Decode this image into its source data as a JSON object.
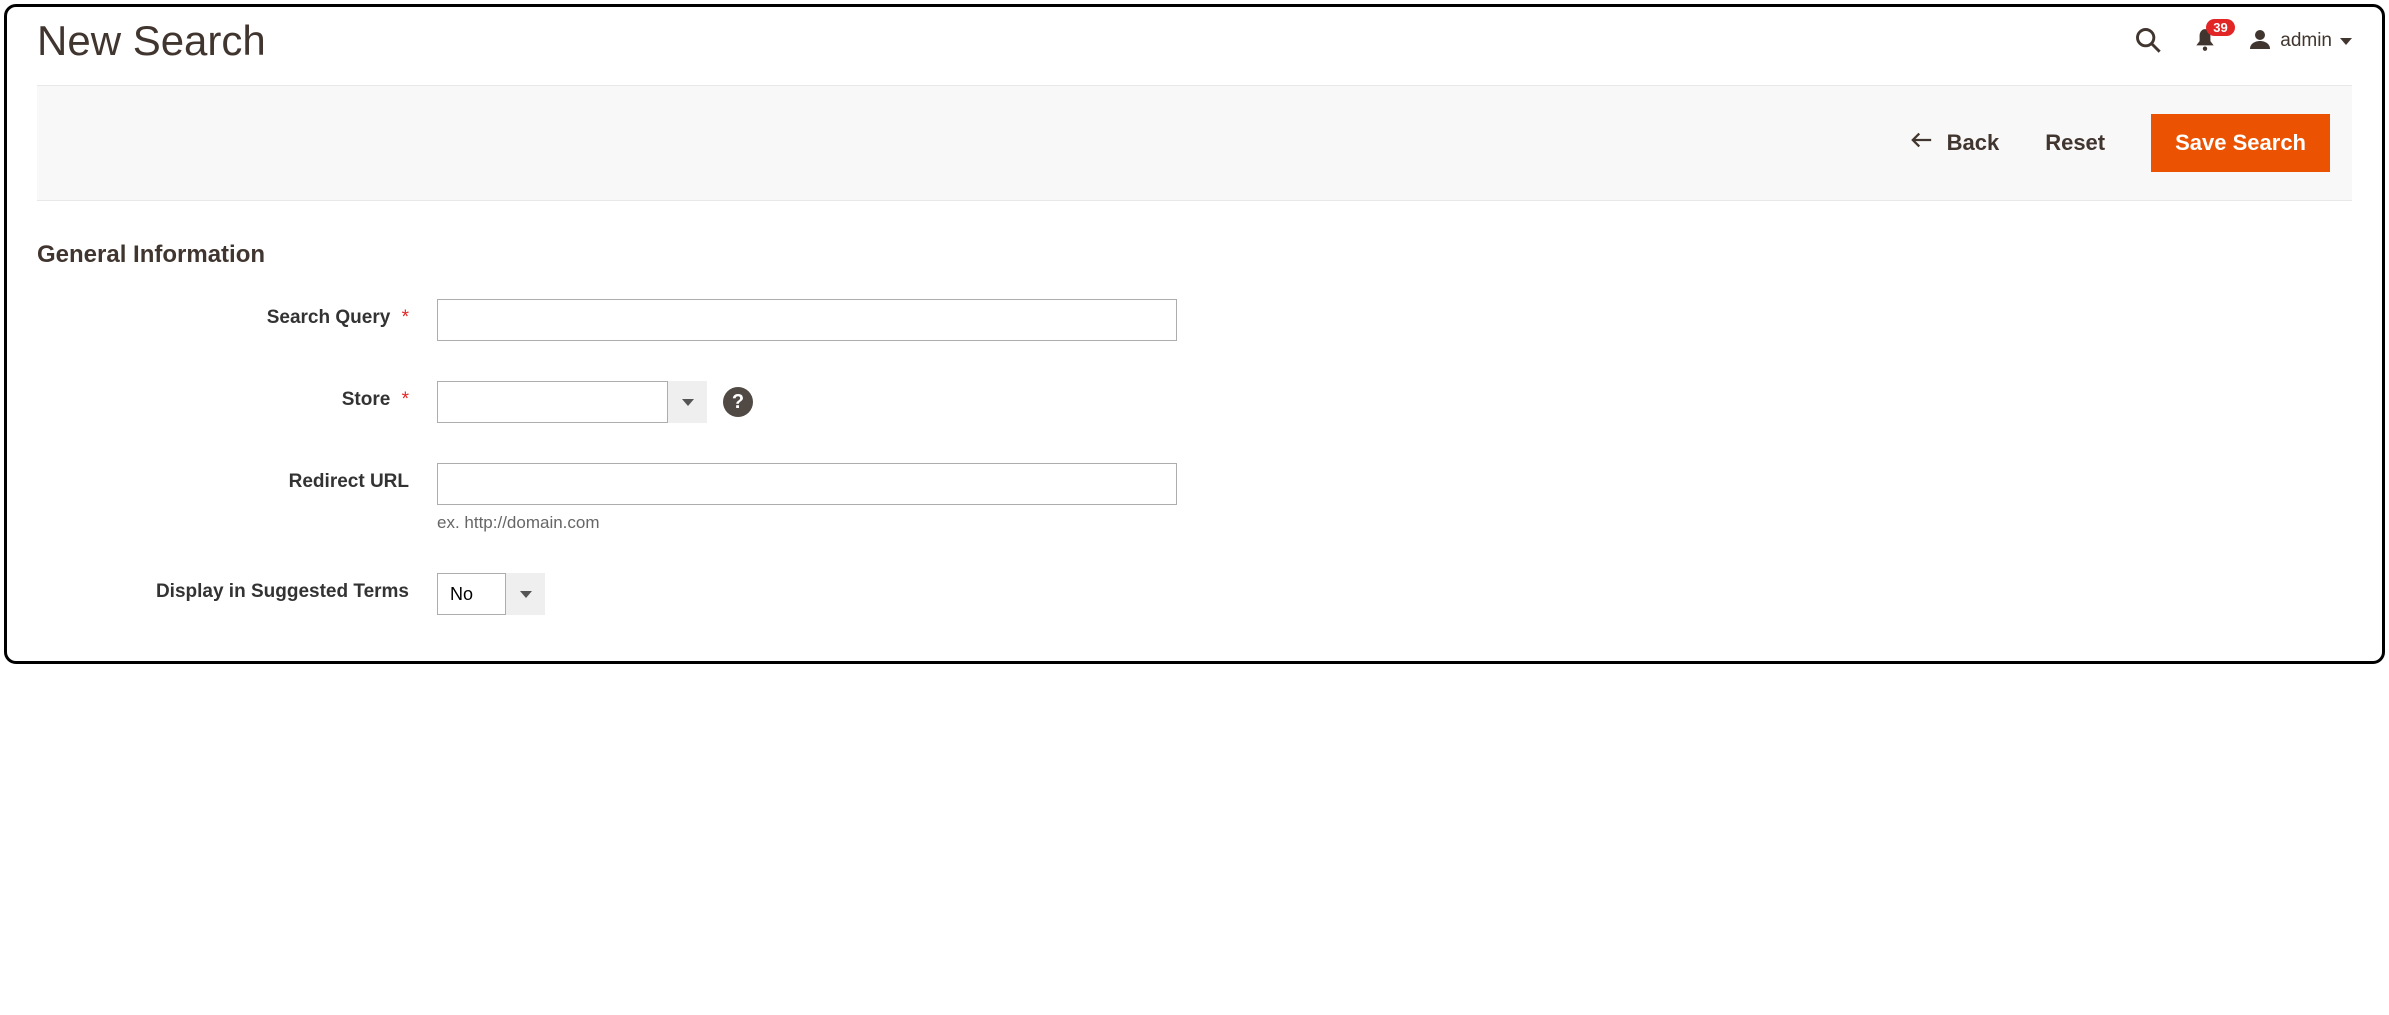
{
  "header": {
    "title": "New Search",
    "notification_count": "39",
    "user_name": "admin"
  },
  "actions": {
    "back_label": "Back",
    "reset_label": "Reset",
    "save_label": "Save Search"
  },
  "section": {
    "title": "General Information"
  },
  "fields": {
    "search_query": {
      "label": "Search Query",
      "value": ""
    },
    "store": {
      "label": "Store",
      "value": ""
    },
    "redirect_url": {
      "label": "Redirect URL",
      "value": "",
      "hint": "ex. http://domain.com"
    },
    "display_suggested": {
      "label": "Display in Suggested Terms",
      "value": "No"
    }
  },
  "required_mark": "*",
  "tooltip_char": "?"
}
